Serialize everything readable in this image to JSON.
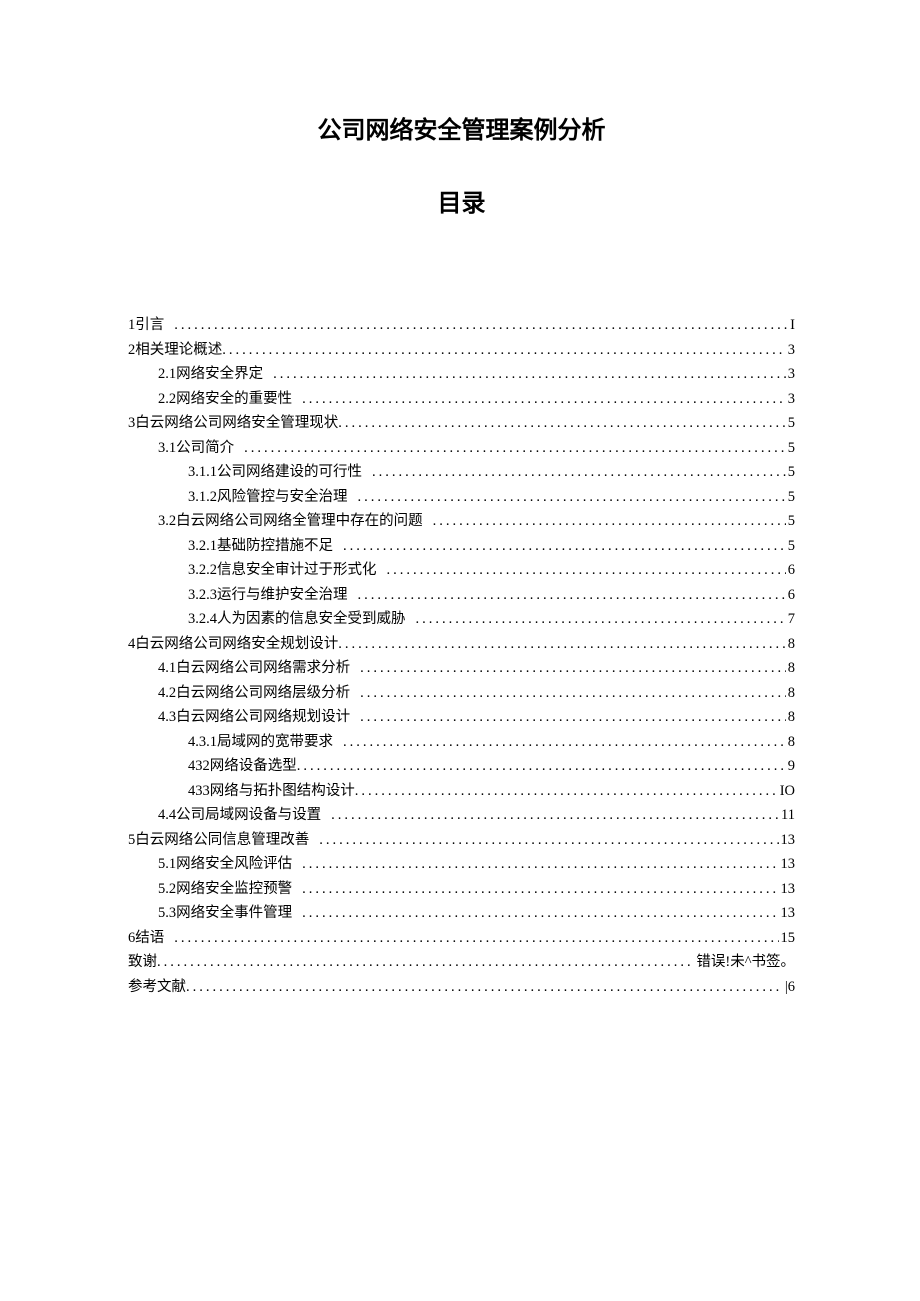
{
  "title": "公司网络安全管理案例分析",
  "subtitle": "目录",
  "toc": [
    {
      "indent": 0,
      "num": "1",
      "label": "引言",
      "gap": true,
      "page": "I"
    },
    {
      "indent": 0,
      "num": "2",
      "label": "相关理论概述",
      "gap": false,
      "page": "3"
    },
    {
      "indent": 1,
      "num": "2.1",
      "label": "网络安全界定",
      "gap": true,
      "page": "3"
    },
    {
      "indent": 1,
      "num": "2.2",
      "label": "网络安全的重要性",
      "gap": true,
      "page": "3"
    },
    {
      "indent": 0,
      "num": "3",
      "label": "白云网络公司网络安全管理现状",
      "gap": false,
      "page": "5"
    },
    {
      "indent": 1,
      "num": "3.1",
      "label": "公司简介",
      "gap": true,
      "page": "5"
    },
    {
      "indent": 2,
      "num": "3.1.1",
      "label": "公司网络建设的可行性",
      "gap": true,
      "page": "5"
    },
    {
      "indent": 2,
      "num": "3.1.2",
      "label": "风险管控与安全治理",
      "gap": true,
      "page": "5"
    },
    {
      "indent": 1,
      "num": "3.2",
      "label": "白云网络公司网络全管理中存在的问题",
      "gap": true,
      "page": "5"
    },
    {
      "indent": 2,
      "num": "3.2.1",
      "label": "基础防控措施不足",
      "gap": true,
      "page": "5"
    },
    {
      "indent": 2,
      "num": "3.2.2",
      "label": "信息安全审计过于形式化",
      "gap": true,
      "page": "6"
    },
    {
      "indent": 2,
      "num": "3.2.3",
      "label": "运行与维护安全治理",
      "gap": true,
      "page": "6"
    },
    {
      "indent": 2,
      "num": "3.2.4",
      "label": "人为因素的信息安全受到威胁",
      "gap": true,
      "page": "7"
    },
    {
      "indent": 0,
      "num": "4",
      "label": "白云网络公司网络安全规划设计",
      "gap": false,
      "page": "8"
    },
    {
      "indent": 1,
      "num": "4.1",
      "label": "白云网络公司网络需求分析",
      "gap": true,
      "page": "8"
    },
    {
      "indent": 1,
      "num": "4.2",
      "label": "白云网络公司网络层级分析",
      "gap": true,
      "page": "8"
    },
    {
      "indent": 1,
      "num": "4.3",
      "label": "白云网络公司网络规划设计",
      "gap": true,
      "page": "8"
    },
    {
      "indent": 2,
      "num": "4.3.1",
      "label": "局域网的宽带要求",
      "gap": true,
      "page": "8"
    },
    {
      "indent": 2,
      "num": "432",
      "label": "网络设备选型",
      "gap": false,
      "page": "9"
    },
    {
      "indent": 2,
      "num": "433",
      "label": "网络与拓扑图结构设计",
      "gap": false,
      "page": "IO"
    },
    {
      "indent": 1,
      "num": "4.4",
      "label": "公司局域网设备与设置",
      "gap": true,
      "page": "11"
    },
    {
      "indent": 0,
      "num": "5",
      "label": "白云网络公同信息管理改善",
      "gap": true,
      "page": "13"
    },
    {
      "indent": 1,
      "num": "5.1",
      "label": "网络安全风险评估",
      "gap": true,
      "page": "13"
    },
    {
      "indent": 1,
      "num": "5.2",
      "label": "网络安全监控预警",
      "gap": true,
      "page": "13"
    },
    {
      "indent": 1,
      "num": "5.3",
      "label": "网络安全事件管理",
      "gap": true,
      "page": "13"
    },
    {
      "indent": 0,
      "num": "6",
      "label": "结语",
      "gap": true,
      "page": "15"
    },
    {
      "indent": 0,
      "num": "",
      "label": "致谢",
      "gap": false,
      "page": "错误!未^书签。"
    },
    {
      "indent": 0,
      "num": "",
      "label": "参考文献",
      "gap": false,
      "page": "|6"
    }
  ]
}
